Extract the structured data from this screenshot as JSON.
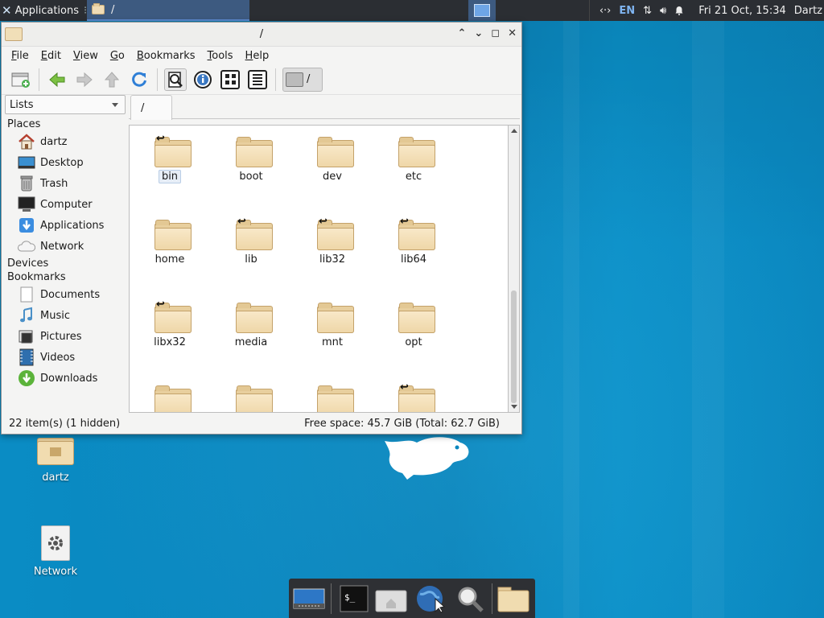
{
  "panel": {
    "applications_label": "Applications",
    "task_title": "/",
    "lang": "EN",
    "clock": "Fri 21 Oct, 15:34",
    "user": "Dartz"
  },
  "window": {
    "title": "/",
    "menu": [
      "File",
      "Edit",
      "View",
      "Go",
      "Bookmarks",
      "Tools",
      "Help"
    ],
    "path_label": "/",
    "tab_label": "/",
    "side_pane_mode": "Lists"
  },
  "sidebar": {
    "places_header": "Places",
    "places": [
      {
        "label": "dartz",
        "icon": "home-icon"
      },
      {
        "label": "Desktop",
        "icon": "desktop-icon"
      },
      {
        "label": "Trash",
        "icon": "trash-icon"
      },
      {
        "label": "Computer",
        "icon": "computer-icon"
      },
      {
        "label": "Applications",
        "icon": "applications-icon"
      },
      {
        "label": "Network",
        "icon": "network-icon"
      }
    ],
    "devices_header": "Devices",
    "bookmarks_header": "Bookmarks",
    "bookmarks": [
      {
        "label": "Documents",
        "icon": "documents-icon"
      },
      {
        "label": "Music",
        "icon": "music-icon"
      },
      {
        "label": "Pictures",
        "icon": "pictures-icon"
      },
      {
        "label": "Videos",
        "icon": "videos-icon"
      },
      {
        "label": "Downloads",
        "icon": "downloads-icon"
      }
    ]
  },
  "files": [
    {
      "name": "bin",
      "symlink": true,
      "selected": true
    },
    {
      "name": "boot",
      "symlink": false
    },
    {
      "name": "dev",
      "symlink": false
    },
    {
      "name": "etc",
      "symlink": false
    },
    {
      "name": "home",
      "symlink": false
    },
    {
      "name": "lib",
      "symlink": true
    },
    {
      "name": "lib32",
      "symlink": true
    },
    {
      "name": "lib64",
      "symlink": true
    },
    {
      "name": "libx32",
      "symlink": true
    },
    {
      "name": "media",
      "symlink": false
    },
    {
      "name": "mnt",
      "symlink": false
    },
    {
      "name": "opt",
      "symlink": false
    },
    {
      "name": "",
      "symlink": false
    },
    {
      "name": "",
      "symlink": false
    },
    {
      "name": "",
      "symlink": false
    },
    {
      "name": "",
      "symlink": true
    }
  ],
  "status": {
    "items": "22 item(s) (1 hidden)",
    "free_space": "Free space: 45.7 GiB (Total: 62.7 GiB)"
  },
  "desktop": {
    "icons": [
      {
        "label": "dartz",
        "icon": "home-folder-icon"
      },
      {
        "label": "Network",
        "icon": "network-settings-icon"
      }
    ]
  },
  "colors": {
    "panel_bg": "#2b2e33",
    "desktop_blue": "#0a86be",
    "folder": "#efd7a8",
    "accent": "#3d5a80"
  }
}
